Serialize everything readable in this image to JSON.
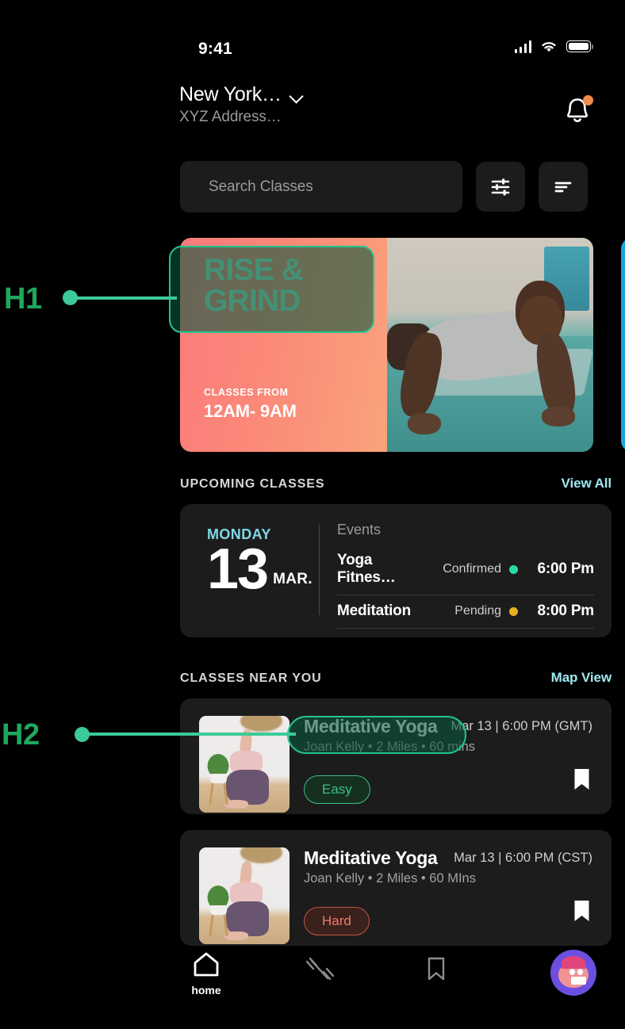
{
  "status_bar": {
    "time": "9:41",
    "icons": [
      "signal-icon",
      "wifi-icon",
      "battery-icon"
    ]
  },
  "header": {
    "city": "New York…",
    "address": "XYZ Address…",
    "chevron_icon": "chevron-down-icon",
    "bell_icon": "notification-bell-icon",
    "has_notification": true,
    "badge_color": "#F08C4B"
  },
  "search": {
    "placeholder": "Search Classes",
    "filter_icon": "sliders-filter-icon",
    "sort_icon": "sort-lines-icon"
  },
  "hero": {
    "title_line1": "RISE &",
    "title_line2": "GRIND",
    "kicker": "CLASSES FROM",
    "time_range": "12AM- 9AM",
    "title_color": "#9FE6CA",
    "gradient_from": "#FB7B7C",
    "gradient_to": "#F9A37C",
    "photo_alt": "man-doing-pushups-photo",
    "next_card_color": "#1CA5E0"
  },
  "upcoming": {
    "section_title": "UPCOMING CLASSES",
    "link": "View All",
    "day": "MONDAY",
    "date": "13",
    "month": "MAR.",
    "events_label": "Events",
    "events": [
      {
        "name": "Yoga Fitnes…",
        "status": "Confirmed",
        "status_color": "#2AD9A5",
        "time": "6:00 Pm"
      },
      {
        "name": "Meditation",
        "status": "Pending",
        "status_color": "#E8B020",
        "time": "8:00 Pm"
      }
    ]
  },
  "near_you": {
    "section_title": "CLASSES NEAR YOU",
    "link": "Map View",
    "classes": [
      {
        "title": "Meditative Yoga",
        "meta": "Joan Kelly  •  2 Miles  •  60 mins",
        "when": "Mar 13 | 6:00 PM (GMT)",
        "badge": "Easy",
        "badge_type": "easy",
        "bookmark_icon": "bookmark-icon",
        "thumb_alt": "yoga-pose-thumbnail"
      },
      {
        "title": "Meditative Yoga",
        "meta": "Joan Kelly  •  2 Miles  •  60 MIns",
        "when": "Mar 13 | 6:00 PM (CST)",
        "badge": "Hard",
        "badge_type": "hard",
        "bookmark_icon": "bookmark-icon",
        "thumb_alt": "yoga-pose-thumbnail"
      }
    ]
  },
  "bottom_nav": {
    "items": [
      {
        "icon": "home-icon",
        "label": "home",
        "active": true
      },
      {
        "icon": "dumbbell-icon",
        "label": "",
        "active": false
      },
      {
        "icon": "bookmark-icon",
        "label": "",
        "active": false
      },
      {
        "icon": "avatar-icon",
        "label": "",
        "active": false
      }
    ]
  },
  "annotations": [
    {
      "id": "H1",
      "label": "H1",
      "target": "hero-title-highlight"
    },
    {
      "id": "H2",
      "label": "H2",
      "target": "class-title-highlight"
    }
  ],
  "annotation_color": "#1EA85C",
  "annotation_accent": "#3CCB98"
}
